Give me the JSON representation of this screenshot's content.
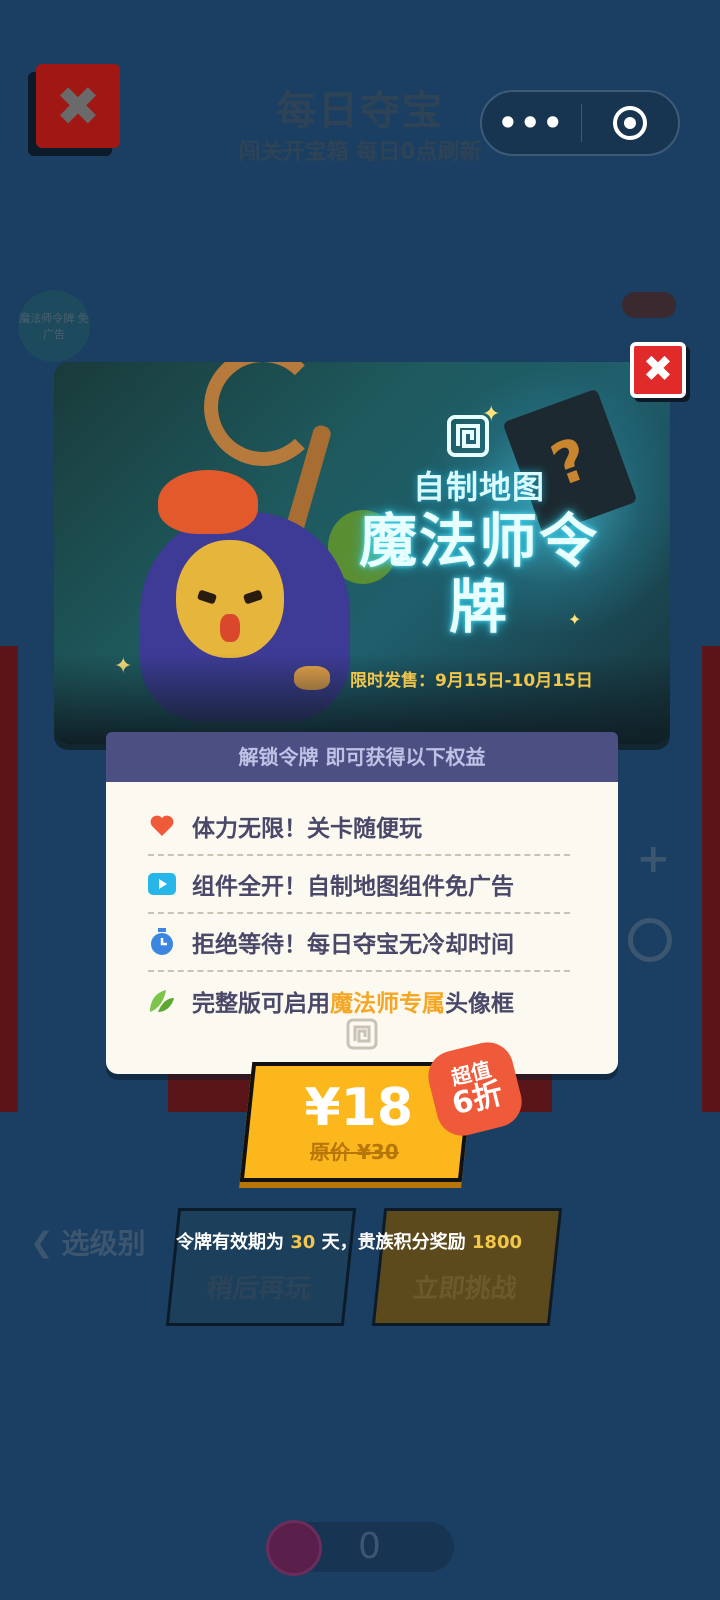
{
  "background": {
    "title": "每日夺宝",
    "subtitle": "闯关开宝箱 每日0点刷新",
    "badge_text": "魔法师令牌 免广告",
    "back_label": "选级别",
    "later_label": "稍后再玩",
    "challenge_label": "立即挑战",
    "coin_value": "0"
  },
  "capsule": {
    "more_label": "•••"
  },
  "banner": {
    "subtitle": "自制地图",
    "title": "魔法师令牌",
    "date_label": "限时发售：",
    "date_range": "9月15日-10月15日"
  },
  "benefits_header": "解锁令牌 即可获得以下权益",
  "benefits": [
    {
      "icon": "heart-icon",
      "text": "体力无限！关卡随便玩"
    },
    {
      "icon": "play-icon",
      "text": "组件全开！自制地图组件免广告"
    },
    {
      "icon": "timer-icon",
      "text": "拒绝等待！每日夺宝无冷却时间"
    },
    {
      "icon": "leaf-icon",
      "text_before": "完整版可启用",
      "text_highlight": "魔法师专属",
      "text_after": "头像框"
    }
  ],
  "purchase": {
    "price": "¥18",
    "original_price": "原价 ¥30",
    "discount_line1": "超值",
    "discount_line2": "6折"
  },
  "validity": {
    "prefix": "令牌有效期为",
    "days": "30",
    "mid": "天，贵族积分奖励",
    "points": "1800"
  },
  "colors": {
    "accent_yellow": "#fcb71c",
    "highlight": "#f5a623",
    "close_red": "#e12b2b",
    "header_purple": "#4c4f82"
  }
}
